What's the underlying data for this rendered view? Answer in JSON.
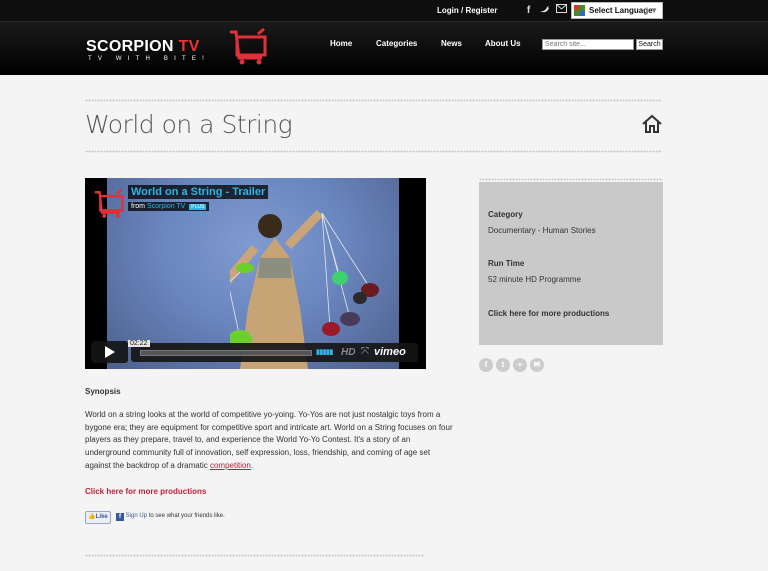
{
  "topbar": {
    "login_label": "Login / Register",
    "icons": [
      "facebook-icon",
      "twitter-icon",
      "email-icon"
    ],
    "language_label": "Select Language"
  },
  "header": {
    "logo_main": "SCORPION",
    "logo_tv": "TV",
    "logo_tagline": "TV WITH BITE!",
    "nav": [
      "Home",
      "Categories",
      "News",
      "About Us"
    ],
    "search_placeholder": "Search site...",
    "search_button": "Search"
  },
  "page": {
    "title": "World on a String"
  },
  "video": {
    "title": "World on a String - Trailer",
    "from_label": "from",
    "from_name": "Scorpion TV",
    "plus_badge": "PLUS",
    "time": "02:22",
    "hd_label": "HD",
    "brand": "vimeo",
    "progress": 0
  },
  "synopsis": {
    "heading": "Synopsis",
    "text": "World on a string looks at the world of competitive yo-yoing. Yo-Yos are not just nostalgic toys from a bygone era; they are equipment for competitive sport and intricate art. World on a String focuses on four players as they prepare, travel to, and experience the World Yo-Yo Contest. It's a story of an underground community full of innovation, self expression, loss, friendship, and coming of age set against the backdrop of a dramatic ",
    "link": "competition",
    "end": "."
  },
  "more_link": "Click here for more productions",
  "facebook": {
    "like": "Like",
    "signup": "Sign Up",
    "signup_rest": " to see what your friends like."
  },
  "sidebar": {
    "category_label": "Category",
    "category_value": "Documentary - Human Stories",
    "runtime_label": "Run Time",
    "runtime_value": "52 minute HD Programme",
    "more_link": "Click here for more productions"
  },
  "share_icons": [
    "facebook-share-icon",
    "twitter-share-icon",
    "google-plus-share-icon",
    "email-share-icon"
  ],
  "colors": {
    "accent": "#c0223d",
    "vimeo_blue": "#2fb6e6",
    "header_bg": "#000000",
    "sidebar_bg": "#c9c9c9"
  }
}
